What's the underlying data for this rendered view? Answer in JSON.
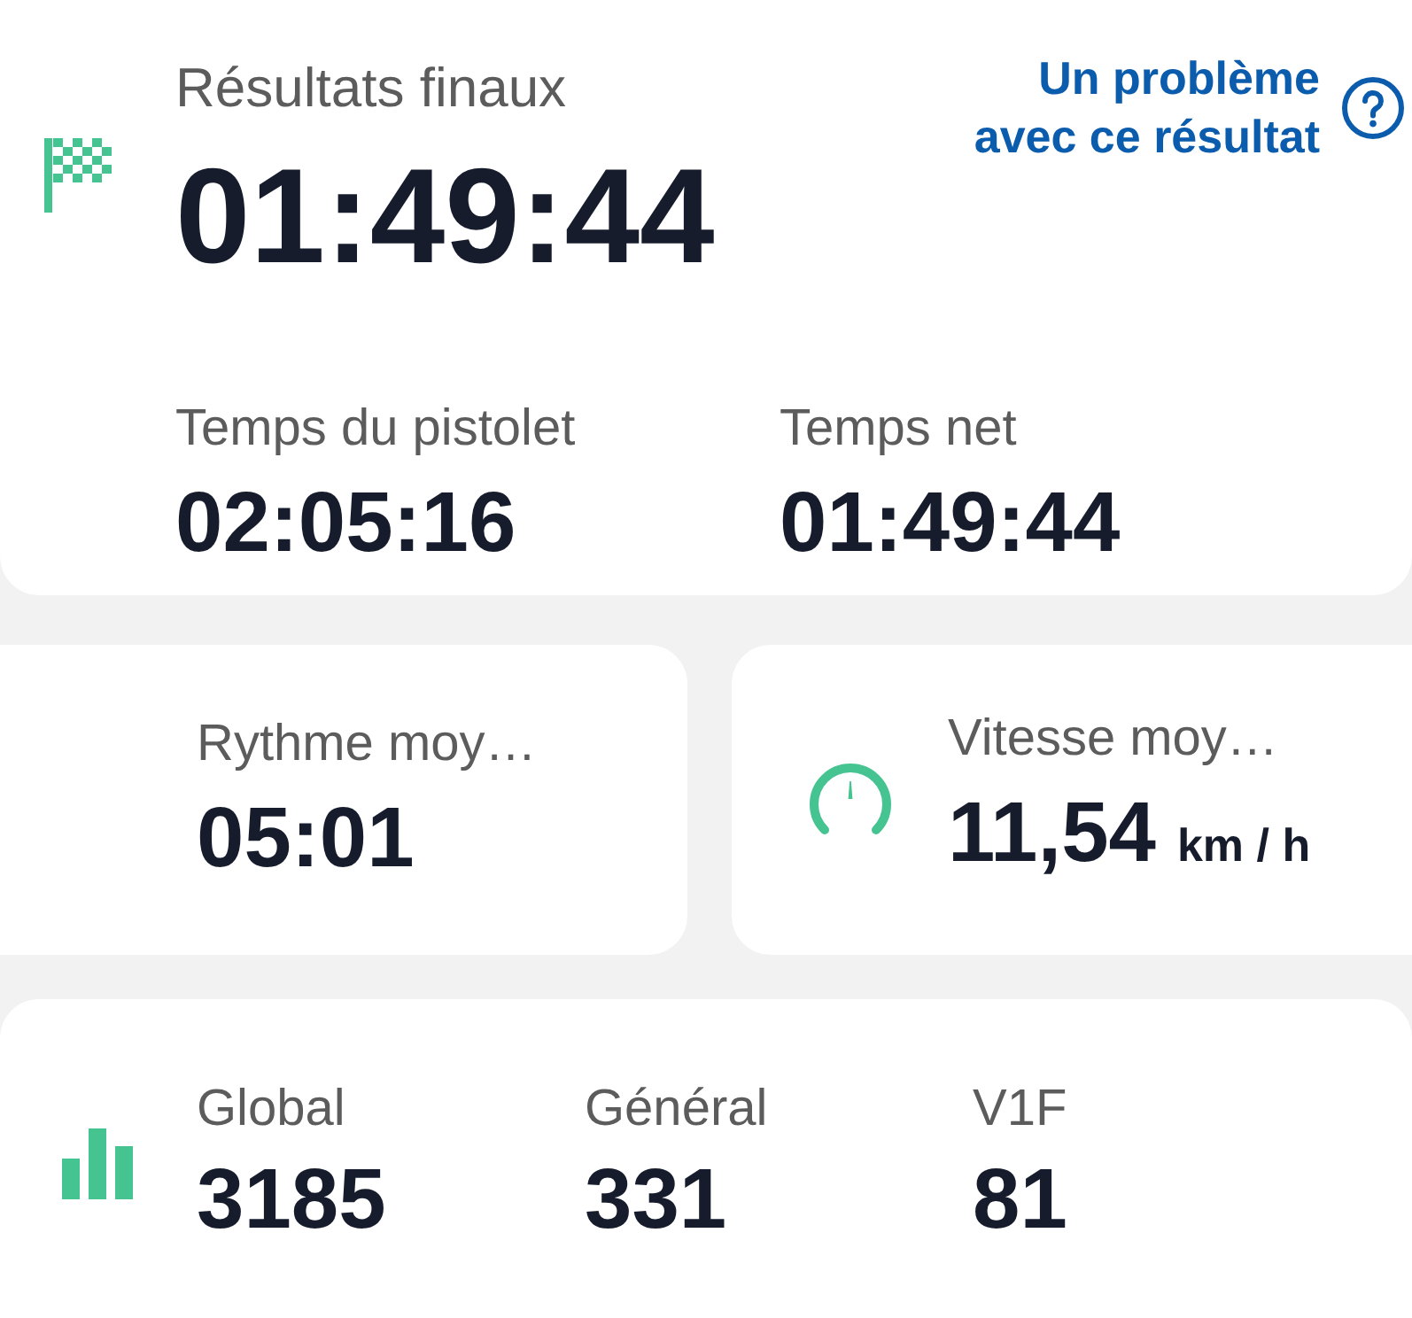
{
  "header": {
    "title": "Résultats finaux",
    "final_time": "01:49:44",
    "report_link": "Un problème avec ce résultat"
  },
  "times": [
    {
      "label": "Temps du pistolet",
      "value": "02:05:16"
    },
    {
      "label": "Temps net",
      "value": "01:49:44"
    }
  ],
  "averages": [
    {
      "kind": "pace",
      "label": "Rythme moy…",
      "value": "05:01"
    },
    {
      "kind": "speed",
      "label": "Vitesse moy…",
      "value": "11,54",
      "unit": "km / h"
    }
  ],
  "rankings": [
    {
      "label": "Global",
      "value": "3185"
    },
    {
      "label": "Général",
      "value": "331"
    },
    {
      "label": "V1F",
      "value": "81"
    }
  ]
}
